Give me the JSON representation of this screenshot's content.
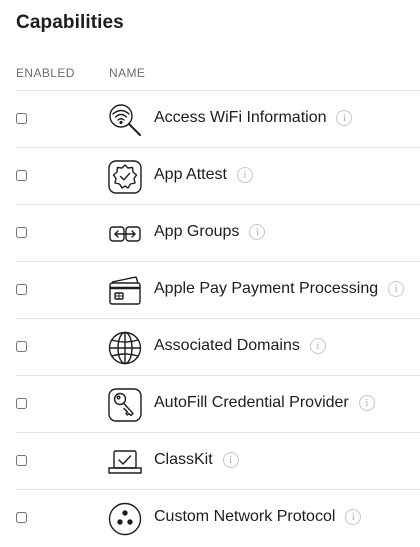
{
  "page": {
    "title": "Capabilities"
  },
  "columns": {
    "enabled": "ENABLED",
    "name": "NAME"
  },
  "capabilities": [
    {
      "label": "Access WiFi Information",
      "icon": "wifi-search-icon",
      "enabled": false
    },
    {
      "label": "App Attest",
      "icon": "app-attest-badge-icon",
      "enabled": false
    },
    {
      "label": "App Groups",
      "icon": "app-groups-icon",
      "enabled": false
    },
    {
      "label": "Apple Pay Payment Processing",
      "icon": "credit-card-icon",
      "enabled": false
    },
    {
      "label": "Associated Domains",
      "icon": "globe-icon",
      "enabled": false
    },
    {
      "label": "AutoFill Credential Provider",
      "icon": "key-icon",
      "enabled": false
    },
    {
      "label": "ClassKit",
      "icon": "classkit-laptop-icon",
      "enabled": false
    },
    {
      "label": "Custom Network Protocol",
      "icon": "network-protocol-icon",
      "enabled": false
    }
  ],
  "info_glyph": "i",
  "colors": {
    "text": "#1d1d1f",
    "muted": "#6e6e73",
    "separator": "#e6e6e6"
  }
}
